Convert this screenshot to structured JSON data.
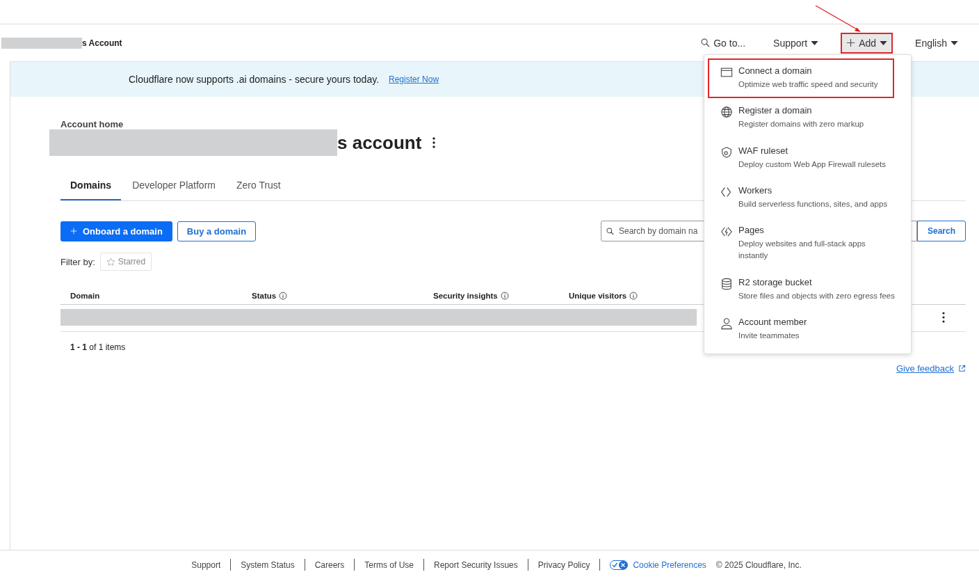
{
  "header": {
    "account_suffix": "s Account",
    "nav": [
      {
        "kind": "search",
        "label": "Go to...",
        "highlighted": false
      },
      {
        "kind": "dropdown",
        "label": "Support",
        "highlighted": false
      },
      {
        "kind": "add",
        "label": "Add",
        "highlighted": true
      },
      {
        "kind": "dropdown",
        "label": "English",
        "highlighted": false
      }
    ]
  },
  "banner": {
    "text": "Cloudflare now supports .ai domains - secure yours today.",
    "link": "Register Now"
  },
  "page": {
    "breadcrumb": "Account home",
    "title_suffix": "s account"
  },
  "tabs": [
    {
      "label": "Domains",
      "selected": true
    },
    {
      "label": "Developer Platform",
      "selected": false
    },
    {
      "label": "Zero Trust",
      "selected": false
    }
  ],
  "actions": {
    "primary": "Onboard a domain",
    "secondary": "Buy a domain"
  },
  "search": {
    "placeholder": "Search by domain na",
    "button": "Search"
  },
  "filter": {
    "label": "Filter by:",
    "chip": "Starred"
  },
  "table": {
    "columns": [
      {
        "label": "Domain",
        "info": false
      },
      {
        "label": "Status",
        "info": true
      },
      {
        "label": "Security insights",
        "info": true
      },
      {
        "label": "Unique visitors",
        "info": true
      }
    ],
    "rows": [
      {
        "kind": "redacted"
      }
    ]
  },
  "pagination": "**1 - 1** of 1 items",
  "feedback": "Give feedback",
  "footer": {
    "links": [
      "Support",
      "System Status",
      "Careers",
      "Terms of Use",
      "Report Security Issues",
      "Privacy Policy"
    ],
    "cookie": "Cookie Preferences",
    "copyright": "© 2025 Cloudflare, Inc."
  },
  "menu": [
    {
      "kind": "window",
      "title": "Connect a domain",
      "desc": "Optimize web traffic speed and security",
      "highlighted": true
    },
    {
      "kind": "globe",
      "title": "Register a domain",
      "desc": "Register domains with zero markup",
      "highlighted": false
    },
    {
      "kind": "shield",
      "title": "WAF ruleset",
      "desc": "Deploy custom Web App Firewall rulesets",
      "highlighted": false
    },
    {
      "kind": "workers",
      "title": "Workers",
      "desc": "Build serverless functions, sites, and apps",
      "highlighted": false
    },
    {
      "kind": "pages",
      "title": "Pages",
      "desc": "Deploy websites and full-stack apps instantly",
      "highlighted": false
    },
    {
      "kind": "database",
      "title": "R2 storage bucket",
      "desc": "Store files and objects with zero egress fees",
      "highlighted": false
    },
    {
      "kind": "person",
      "title": "Account member",
      "desc": "Invite teammates",
      "highlighted": false
    }
  ]
}
